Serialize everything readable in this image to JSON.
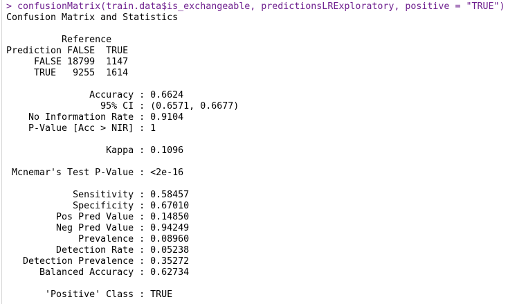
{
  "colors": {
    "command": "#6e1f8e",
    "output": "#000000",
    "background": "#ffffff"
  },
  "console": {
    "command_line": "> confusionMatrix(train.data$is_exchangeable, predictionsLRExploratory, positive = \"TRUE\")",
    "output_lines": [
      "Confusion Matrix and Statistics",
      "",
      "          Reference",
      "Prediction FALSE  TRUE",
      "     FALSE 18799  1147",
      "     TRUE   9255  1614",
      "",
      "               Accuracy : 0.6624",
      "                 95% CI : (0.6571, 0.6677)",
      "    No Information Rate : 0.9104",
      "    P-Value [Acc > NIR] : 1",
      "",
      "                  Kappa : 0.1096",
      "",
      " Mcnemar's Test P-Value : <2e-16",
      "",
      "            Sensitivity : 0.58457",
      "            Specificity : 0.67010",
      "         Pos Pred Value : 0.14850",
      "         Neg Pred Value : 0.94249",
      "             Prevalence : 0.08960",
      "         Detection Rate : 0.05238",
      "   Detection Prevalence : 0.35272",
      "      Balanced Accuracy : 0.62734",
      "",
      "       'Positive' Class : TRUE"
    ]
  }
}
